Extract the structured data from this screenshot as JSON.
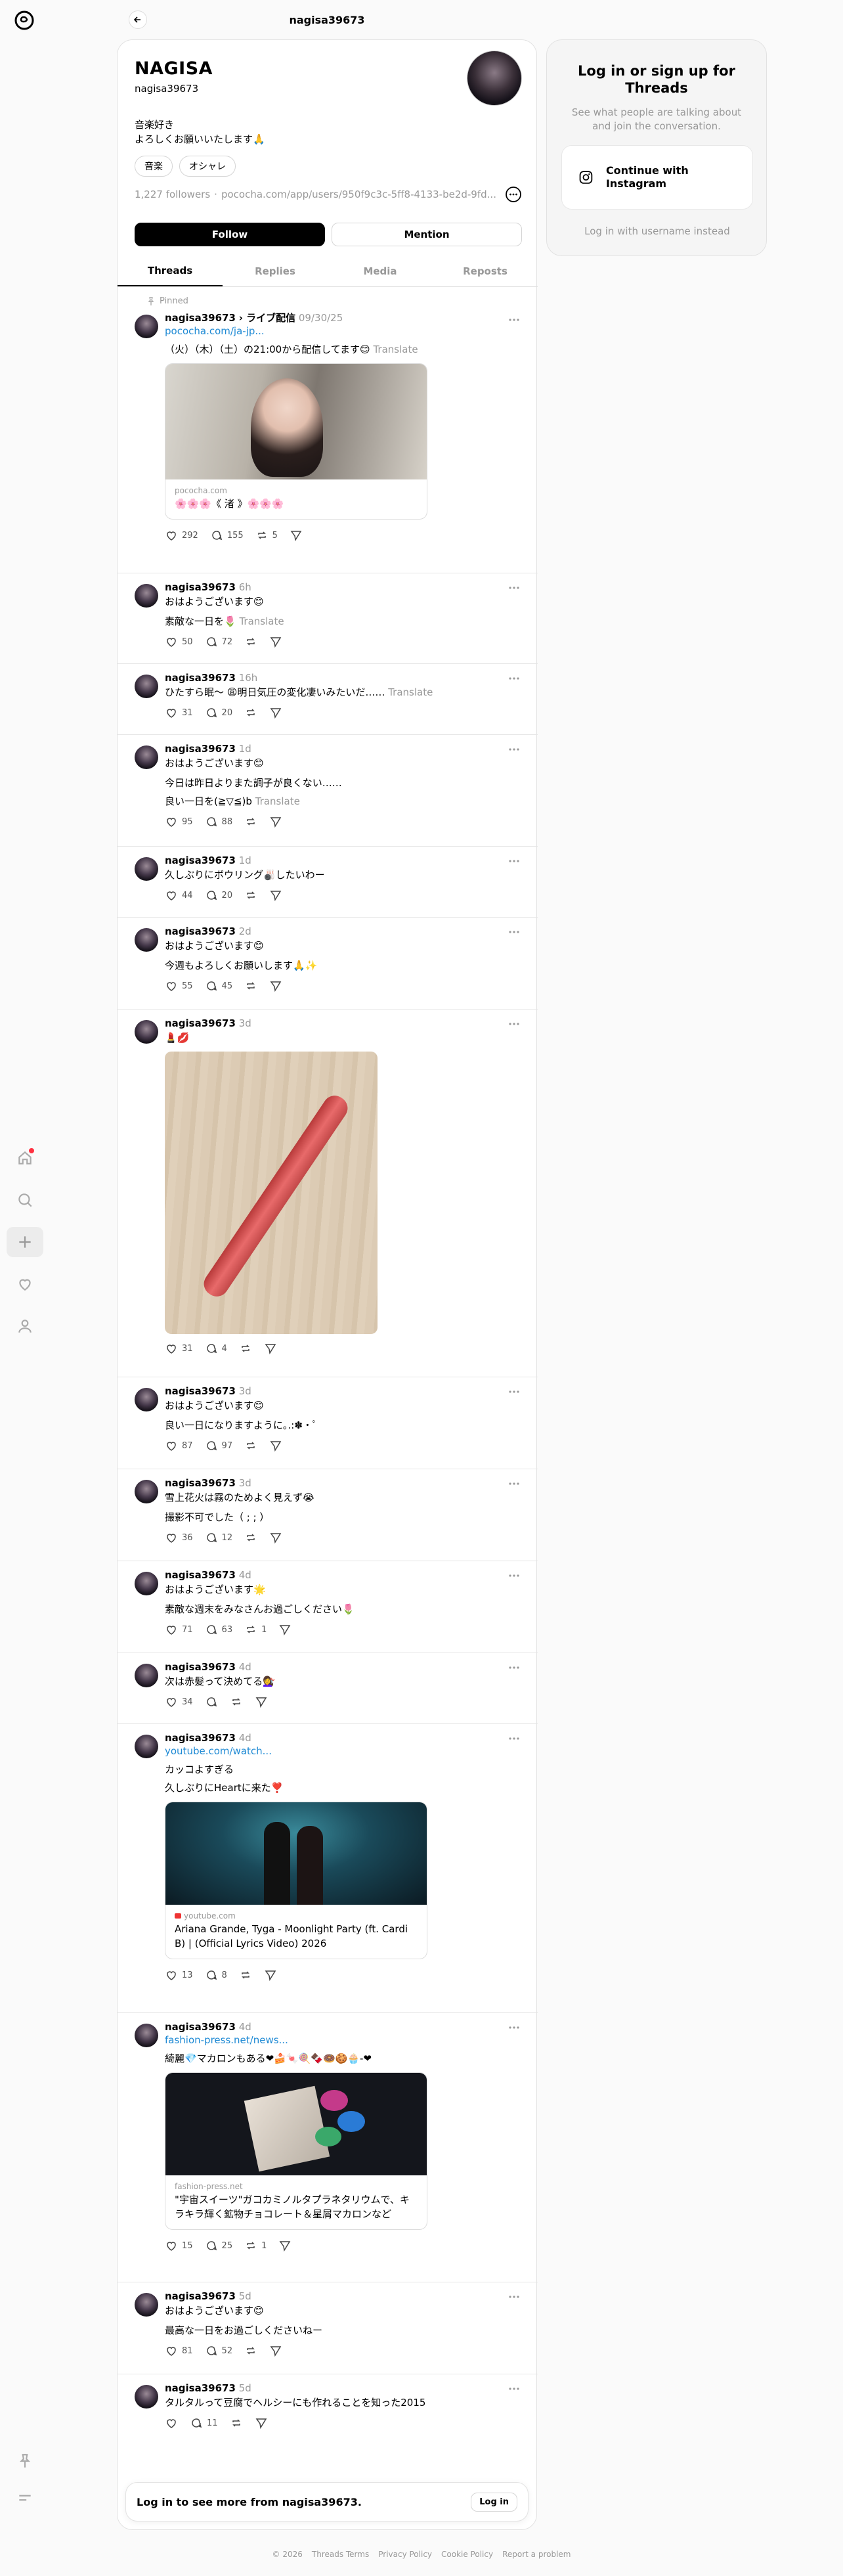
{
  "header": {
    "title": "nagisa39673"
  },
  "profile": {
    "name": "NAGISA",
    "handle": "nagisa39673",
    "bio_lines": [
      "音楽好き",
      "よろしくお願いいたします🙏"
    ],
    "tags": [
      "音楽",
      "オシャレ"
    ],
    "followers": "1,227 followers",
    "separator": "·",
    "url": "pococha.com/app/users/950f9c3c-5ff8-4133-be2d-9fd...",
    "follow_label": "Follow",
    "mention_label": "Mention"
  },
  "tabs": [
    "Threads",
    "Replies",
    "Media",
    "Reposts"
  ],
  "posts": [
    {
      "pinned": "Pinned",
      "user": "nagisa39673",
      "via": "› ライブ配信",
      "time": "09/30/25",
      "link": "pococha.com/ja-jp...",
      "lines": [
        "（火）（木）（土）の21:00から配信してます😊"
      ],
      "translate": "Translate",
      "card_src": "pococha.com",
      "card_title": "🌸🌸🌸《 渚 》🌸🌸🌸",
      "likes": "292",
      "replies": "155",
      "reposts": "5"
    },
    {
      "user": "nagisa39673",
      "time": "6h",
      "lines": [
        "おはようございます😊",
        "素敵な一日を🌷"
      ],
      "translate": "Translate",
      "likes": "50",
      "replies": "72",
      "reposts": ""
    },
    {
      "user": "nagisa39673",
      "time": "16h",
      "lines": [
        "ひたすら眠〜 😩明日気圧の変化凄いみたいだ……"
      ],
      "translate": "Translate",
      "likes": "31",
      "replies": "20",
      "reposts": ""
    },
    {
      "user": "nagisa39673",
      "time": "1d",
      "lines": [
        "おはようございます😊",
        "今日は昨日よりまた調子が良くない……",
        "良い一日を(≧▽≦)b"
      ],
      "translate": "Translate",
      "likes": "95",
      "replies": "88",
      "reposts": ""
    },
    {
      "user": "nagisa39673",
      "time": "1d",
      "lines": [
        "久しぶりにボウリング🎳したいわー"
      ],
      "likes": "44",
      "replies": "20",
      "reposts": ""
    },
    {
      "user": "nagisa39673",
      "time": "2d",
      "lines": [
        "おはようございます😊",
        "今週もよろしくお願いします🙏✨"
      ],
      "likes": "55",
      "replies": "45",
      "reposts": ""
    },
    {
      "user": "nagisa39673",
      "time": "3d",
      "lines": [
        "💄💋"
      ],
      "likes": "31",
      "replies": "4",
      "reposts": ""
    },
    {
      "user": "nagisa39673",
      "time": "3d",
      "lines": [
        "おはようございます😊",
        "良い一日になりますように｡.:✽・ﾟ"
      ],
      "likes": "87",
      "replies": "97",
      "reposts": ""
    },
    {
      "user": "nagisa39673",
      "time": "3d",
      "lines": [
        "雪上花火は霧のためよく見えず😭",
        "撮影不可でした（ ; ; ）"
      ],
      "likes": "36",
      "replies": "12",
      "reposts": ""
    },
    {
      "user": "nagisa39673",
      "time": "4d",
      "lines": [
        "おはようございます🌟",
        "素敵な週末をみなさんお過ごしください🌷"
      ],
      "likes": "71",
      "replies": "63",
      "reposts": "1"
    },
    {
      "user": "nagisa39673",
      "time": "4d",
      "lines": [
        "次は赤髪って決めてる💇‍♀️"
      ],
      "likes": "34",
      "replies": "",
      "reposts": ""
    },
    {
      "user": "nagisa39673",
      "time": "4d",
      "link": "youtube.com/watch...",
      "lines": [
        "カッコよすぎる",
        "久しぶりにHeartに来た❣️"
      ],
      "card_src": "youtube.com",
      "card_title": "Ariana Grande, Tyga - Moonlight Party (ft. Cardi B) | (Official Lyrics Video) 2026",
      "likes": "13",
      "replies": "8",
      "reposts": ""
    },
    {
      "user": "nagisa39673",
      "time": "4d",
      "link": "fashion-press.net/news...",
      "lines": [
        "綺麗💎マカロンもある❤︎🍰🍬🍭🍫🍩🍪🧁-❤︎"
      ],
      "card_src": "fashion-press.net",
      "card_title": "\"宇宙スイーツ\"ガコカミノルタプラネタリウムで、キラキラ輝く鉱物チョコレート＆星屑マカロンなど",
      "likes": "15",
      "replies": "25",
      "reposts": "1"
    },
    {
      "user": "nagisa39673",
      "time": "5d",
      "lines": [
        "おはようございます😊",
        "最高な一日をお過ごしくださいねー"
      ],
      "likes": "81",
      "replies": "52",
      "reposts": ""
    },
    {
      "user": "nagisa39673",
      "time": "5d",
      "lines": [
        "タルタルって豆腐でヘルシーにも作れることを知った2015"
      ],
      "likes": "",
      "replies": "11",
      "reposts": ""
    }
  ],
  "login_bar": {
    "text": "Log in to see more from nagisa39673.",
    "button": "Log in"
  },
  "side": {
    "title": "Log in or sign up for Threads",
    "subtitle": "See what people are talking about and join the conversation.",
    "ig_button": "Continue with Instagram",
    "username_link": "Log in with username instead"
  },
  "footer": [
    "© 2026",
    "Threads Terms",
    "Privacy Policy",
    "Cookie Policy",
    "Report a problem"
  ],
  "colors": {
    "link": "#1f8ad4",
    "notification": "#ff3040"
  }
}
